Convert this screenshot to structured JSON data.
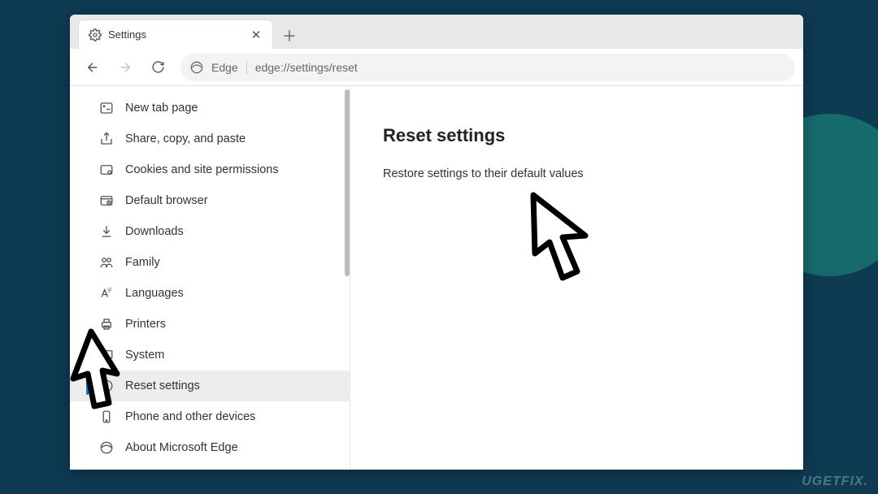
{
  "tab": {
    "title": "Settings"
  },
  "address": {
    "label": "Edge",
    "url": "edge://settings/reset"
  },
  "sidebar": {
    "items": [
      {
        "label": "New tab page"
      },
      {
        "label": "Share, copy, and paste"
      },
      {
        "label": "Cookies and site permissions"
      },
      {
        "label": "Default browser"
      },
      {
        "label": "Downloads"
      },
      {
        "label": "Family"
      },
      {
        "label": "Languages"
      },
      {
        "label": "Printers"
      },
      {
        "label": "System"
      },
      {
        "label": "Reset settings"
      },
      {
        "label": "Phone and other devices"
      },
      {
        "label": "About Microsoft Edge"
      }
    ]
  },
  "main": {
    "heading": "Reset settings",
    "option": "Restore settings to their default values"
  },
  "watermark": "UGETFIX."
}
